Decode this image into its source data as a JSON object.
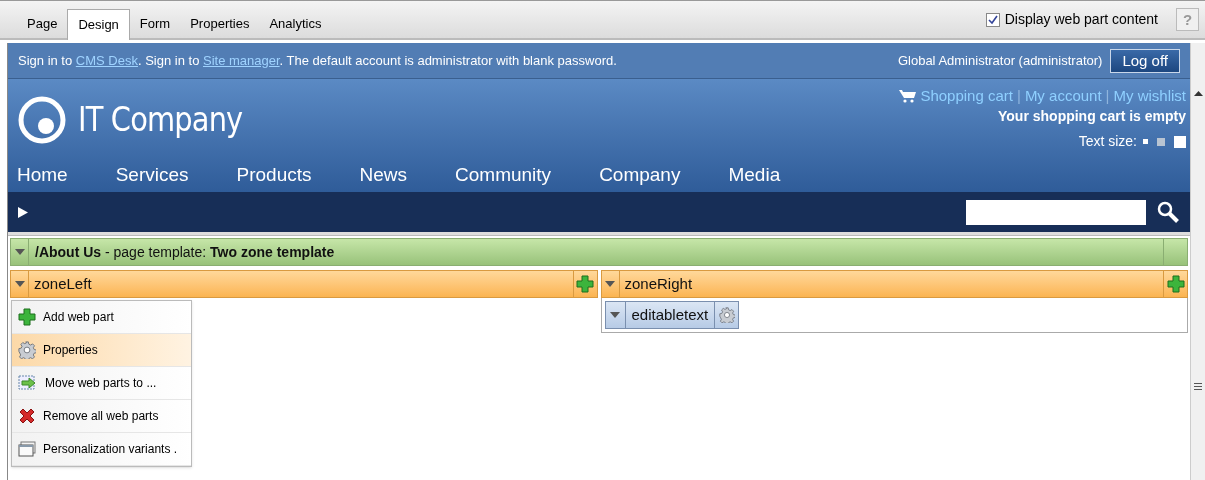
{
  "tabs": [
    {
      "label": "Page",
      "selected": false
    },
    {
      "label": "Design",
      "selected": true
    },
    {
      "label": "Form",
      "selected": false
    },
    {
      "label": "Properties",
      "selected": false
    },
    {
      "label": "Analytics",
      "selected": false
    }
  ],
  "display_option": {
    "label": "Display web part content",
    "checked": true
  },
  "help": "?",
  "info_bar": [
    {
      "text": "Sign in to ",
      "link": false
    },
    {
      "text": "CMS Desk",
      "link": true
    },
    {
      "text": ". Sign in to ",
      "link": false
    },
    {
      "text": "Site manager",
      "link": true
    },
    {
      "text": ". The default account is administrator with blank password.",
      "link": false
    }
  ],
  "user": "Global Administrator (administrator)",
  "logoff": "Log off",
  "logo": "IT Company",
  "shop_links": [
    "Shopping cart",
    "My account",
    "My wishlist"
  ],
  "separator": "|",
  "cart_status": "Your shopping cart is empty",
  "text_size_label": "Text size:",
  "nav": [
    "Home",
    "Services",
    "Products",
    "News",
    "Community",
    "Company",
    "Media"
  ],
  "template": "**/About Us** - page template: **Two zone template**",
  "zones": [
    {
      "name": "zoneLeft"
    },
    {
      "name": "zoneRight",
      "web_parts": [
        "editabletext"
      ]
    }
  ],
  "context_menu": [
    {
      "label": "Add web part",
      "kind": "add",
      "selected": false
    },
    {
      "label": "Properties",
      "kind": "gear",
      "selected": true
    },
    {
      "label": "Move web parts to ...",
      "kind": "move",
      "selected": false
    },
    {
      "label": "Remove all web parts",
      "kind": "remove",
      "selected": false
    },
    {
      "label": "Personalization variants .",
      "kind": "variants",
      "selected": false
    }
  ]
}
